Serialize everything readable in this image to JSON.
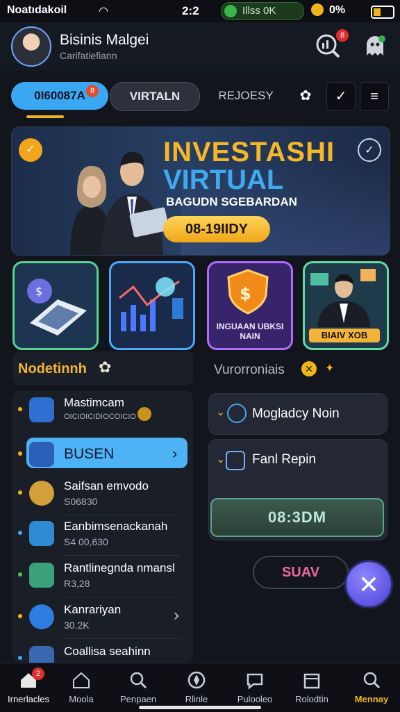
{
  "status_bar": {
    "carrier": "Noatıdakoil",
    "time": "2:2",
    "pill_text": "Illss 0K",
    "battery_pct": "0%"
  },
  "header": {
    "user_name": "Bisinis Malgei",
    "user_sub": "Carifatiefiann",
    "notif_badge": "8"
  },
  "tabs": {
    "active": "0I60087A",
    "second": "VIRTALN",
    "third": "REJOESY",
    "active_badge": "8"
  },
  "banner": {
    "title_line1": "INVESTASHI",
    "title_line2": "VIRTUAL",
    "subtitle": "BAGUDN SGEBARDAN",
    "cta": "08-19IIDY"
  },
  "features": [
    {
      "name": "laptop-card",
      "label": ""
    },
    {
      "name": "chart-card",
      "label": ""
    },
    {
      "name": "shield-card",
      "label": "INGUAAN UBKSI NAIN"
    },
    {
      "name": "advisor-card",
      "label": "BIAIV XOB"
    }
  ],
  "sections": {
    "left_title": "Nodetinnh",
    "right_title": "Vurorroniais"
  },
  "left_list": [
    {
      "name": "Mastimcam",
      "sub": "OICIOICIDIOCOICIO"
    },
    {
      "name": "BUSEN",
      "sub": ""
    },
    {
      "name": "Saifsan emvodo",
      "sub": "S06830"
    },
    {
      "name": "Eanbimsenackanah",
      "sub": "S4 00,630"
    },
    {
      "name": "Rantlinegnda nmansl",
      "sub": "R3,28"
    },
    {
      "name": "Kanrariyan",
      "sub": "30.2K"
    },
    {
      "name": "Coallisa seahinn",
      "sub": ""
    }
  ],
  "right_panel": {
    "card1": "Mogladcy Noin",
    "card2": "Fanl Repin",
    "time_value": "08:3DM",
    "outline_button": "SUAV"
  },
  "bottom_nav": [
    {
      "label": "Irnerlacles",
      "badge": "2"
    },
    {
      "label": "Moola"
    },
    {
      "label": "Penpaen"
    },
    {
      "label": "Rlinle"
    },
    {
      "label": "Pulooleo"
    },
    {
      "label": "Rolodtin"
    },
    {
      "label": "Mennay"
    }
  ],
  "colors": {
    "accent_blue": "#3aa7f2",
    "accent_gold": "#f1b51c",
    "background": "#12151c"
  }
}
